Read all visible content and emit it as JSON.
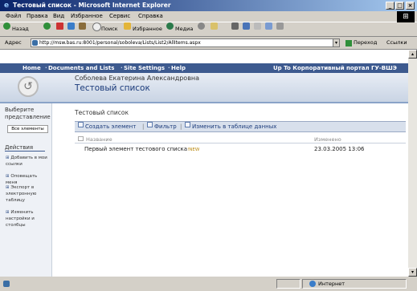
{
  "window": {
    "title": "Тестовый список - Microsoft Internet Explorer"
  },
  "menu": [
    "Файл",
    "Правка",
    "Вид",
    "Избранное",
    "Сервис",
    "Справка"
  ],
  "toolbar": {
    "back": "Назад",
    "search": "Поиск",
    "favorites": "Избранное",
    "media": "Медиа"
  },
  "address": {
    "label": "Адрес",
    "url": "http://msw.bas.ru:8001/personal/soboleva/Lists/List2/AllItems.aspx",
    "go": "Переход",
    "links": "Ссылки"
  },
  "nav": {
    "items": [
      "Home",
      "Documents and Lists",
      "Site Settings",
      "Help"
    ],
    "portal_link": "Up To Корпоративный портал ГУ-ВШЭ"
  },
  "site": {
    "owner": "Соболева Екатерина Александровна",
    "title": "Тестовый список"
  },
  "sidebar": {
    "select_view": "Выберите представление",
    "all_items": "Все элементы",
    "actions_title": "Действия",
    "actions": [
      "Добавить в мои ссылки",
      "Оповещать меня",
      "Экспорт в электронную таблицу",
      "Изменить настройки и столбцы"
    ]
  },
  "list": {
    "title": "Тестовый список",
    "toolbar": {
      "new_item": "Создать элемент",
      "filter": "Фильтр",
      "edit_datasheet": "Изменить в таблице данных"
    },
    "columns": [
      "Название",
      "Изменено"
    ],
    "rows": [
      {
        "title": "Первый элемент тестового списка",
        "badge": "!NEW",
        "modified": "23.03.2005 13:06"
      }
    ]
  },
  "status": {
    "zone": "Интернет"
  },
  "colors": {
    "accent": "#3d5a8f",
    "title_bar": "#0a246a"
  }
}
